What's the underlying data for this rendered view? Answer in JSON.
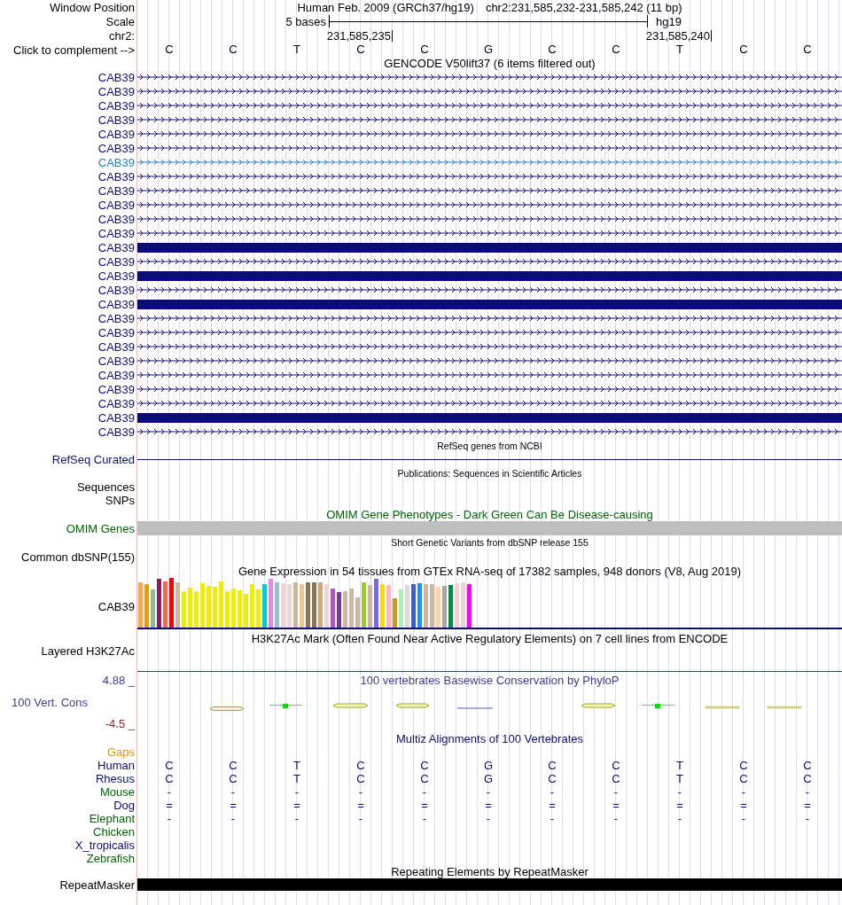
{
  "window_position": {
    "label": "Window Position",
    "assembly": "Human Feb. 2009 (GRCh37/hg19)",
    "position": "chr2:231,585,232-231,585,242 (11 bp)"
  },
  "scale": {
    "label": "Scale",
    "length": "5 bases",
    "assembly": "hg19"
  },
  "chromosome": {
    "label": "chr2:",
    "ticks": [
      "231,585,235",
      "231,585,240"
    ]
  },
  "sequence": {
    "label": "Click to complement -->",
    "bases": [
      "C",
      "C",
      "T",
      "C",
      "C",
      "G",
      "C",
      "C",
      "T",
      "C",
      "C"
    ]
  },
  "gencode": {
    "title": "GENCODE V50lift37 (6 items filtered out)",
    "items": [
      {
        "label": "CAB39",
        "kind": "intron",
        "color": "#0c0c78"
      },
      {
        "label": "CAB39",
        "kind": "intron",
        "color": "#0c0c78"
      },
      {
        "label": "CAB39",
        "kind": "intron",
        "color": "#0c0c78"
      },
      {
        "label": "CAB39",
        "kind": "intron",
        "color": "#0c0c78"
      },
      {
        "label": "CAB39",
        "kind": "intron",
        "color": "#0c0c78"
      },
      {
        "label": "CAB39",
        "kind": "intron",
        "color": "#0c0c78"
      },
      {
        "label": "CAB39",
        "kind": "intron",
        "color": "#2082c0"
      },
      {
        "label": "CAB39",
        "kind": "intron",
        "color": "#0c0c78"
      },
      {
        "label": "CAB39",
        "kind": "intron",
        "color": "#0c0c78"
      },
      {
        "label": "CAB39",
        "kind": "intron",
        "color": "#0c0c78"
      },
      {
        "label": "CAB39",
        "kind": "intron",
        "color": "#0c0c78"
      },
      {
        "label": "CAB39",
        "kind": "intron",
        "color": "#0c0c78"
      },
      {
        "label": "CAB39",
        "kind": "exon",
        "color": "#0c0c78"
      },
      {
        "label": "CAB39",
        "kind": "intron",
        "color": "#0c0c78"
      },
      {
        "label": "CAB39",
        "kind": "exon",
        "color": "#0c0c78"
      },
      {
        "label": "CAB39",
        "kind": "intron",
        "color": "#0c0c78"
      },
      {
        "label": "CAB39",
        "kind": "exon",
        "color": "#0c0c78"
      },
      {
        "label": "CAB39",
        "kind": "intron",
        "color": "#0c0c78"
      },
      {
        "label": "CAB39",
        "kind": "intron",
        "color": "#0c0c78"
      },
      {
        "label": "CAB39",
        "kind": "intron",
        "color": "#0c0c78"
      },
      {
        "label": "CAB39",
        "kind": "intron",
        "color": "#0c0c78"
      },
      {
        "label": "CAB39",
        "kind": "intron",
        "color": "#0c0c78"
      },
      {
        "label": "CAB39",
        "kind": "intron",
        "color": "#0c0c78"
      },
      {
        "label": "CAB39",
        "kind": "intron",
        "color": "#0c0c78"
      },
      {
        "label": "CAB39",
        "kind": "exon",
        "color": "#0c0c78"
      },
      {
        "label": "CAB39",
        "kind": "intron",
        "color": "#0c0c78"
      }
    ]
  },
  "refseq": {
    "title": "RefSeq genes from NCBI",
    "label": "RefSeq Curated"
  },
  "publications": {
    "title": "Publications: Sequences in Scientific Articles",
    "labels": [
      "Sequences",
      "SNPs"
    ]
  },
  "omim": {
    "title": "OMIM Gene Phenotypes - Dark Green Can Be Disease-causing",
    "label": "OMIM Genes"
  },
  "dbsnp": {
    "title": "Short Genetic Variants from dbSNP release 155",
    "label": "Common dbSNP(155)"
  },
  "gtex": {
    "title": "Gene Expression in 54 tissues from GTEx RNA-seq of 17382 samples, 948 donors (V8, Aug 2019)",
    "label": "CAB39"
  },
  "h3k27ac": {
    "title": "H3K27Ac Mark (Often Found Near Active Regulatory Elements) on 7 cell lines from ENCODE",
    "label": "Layered H3K27Ac"
  },
  "conservation": {
    "title": "100 vertebrates Basewise Conservation by PhyloP",
    "label": "100 Vert. Cons",
    "max_label": "4.88 _",
    "min_label": "-4.5 _"
  },
  "multiz": {
    "title": "Multiz Alignments of 100 Vertebrates",
    "gaps_label": "Gaps",
    "species": [
      {
        "name": "Human",
        "color": "#0c0c78",
        "bases": [
          "C",
          "C",
          "T",
          "C",
          "C",
          "G",
          "C",
          "C",
          "T",
          "C",
          "C"
        ]
      },
      {
        "name": "Rhesus",
        "color": "#0c0c78",
        "bases": [
          "C",
          "C",
          "T",
          "C",
          "C",
          "G",
          "C",
          "C",
          "T",
          "C",
          "C"
        ]
      },
      {
        "name": "Mouse",
        "color": "#006400",
        "bases": [
          "-",
          "-",
          "-",
          "-",
          "-",
          "-",
          "-",
          "-",
          "-",
          "-",
          "-"
        ]
      },
      {
        "name": "Dog",
        "color": "#0c0c78",
        "bases": [
          "=",
          "=",
          "=",
          "=",
          "=",
          "=",
          "=",
          "=",
          "=",
          "=",
          "="
        ]
      },
      {
        "name": "Elephant",
        "color": "#006400",
        "bases": [
          "-",
          "-",
          "-",
          "-",
          "-",
          "-",
          "-",
          "-",
          "-",
          "-",
          "-"
        ]
      },
      {
        "name": "Chicken",
        "color": "#006400"
      },
      {
        "name": "X_tropicalis",
        "color": "#0c0c78"
      },
      {
        "name": "Zebrafish",
        "color": "#006400"
      }
    ]
  },
  "repeatmasker": {
    "title": "Repeating Elements by RepeatMasker",
    "label": "RepeatMasker"
  }
}
